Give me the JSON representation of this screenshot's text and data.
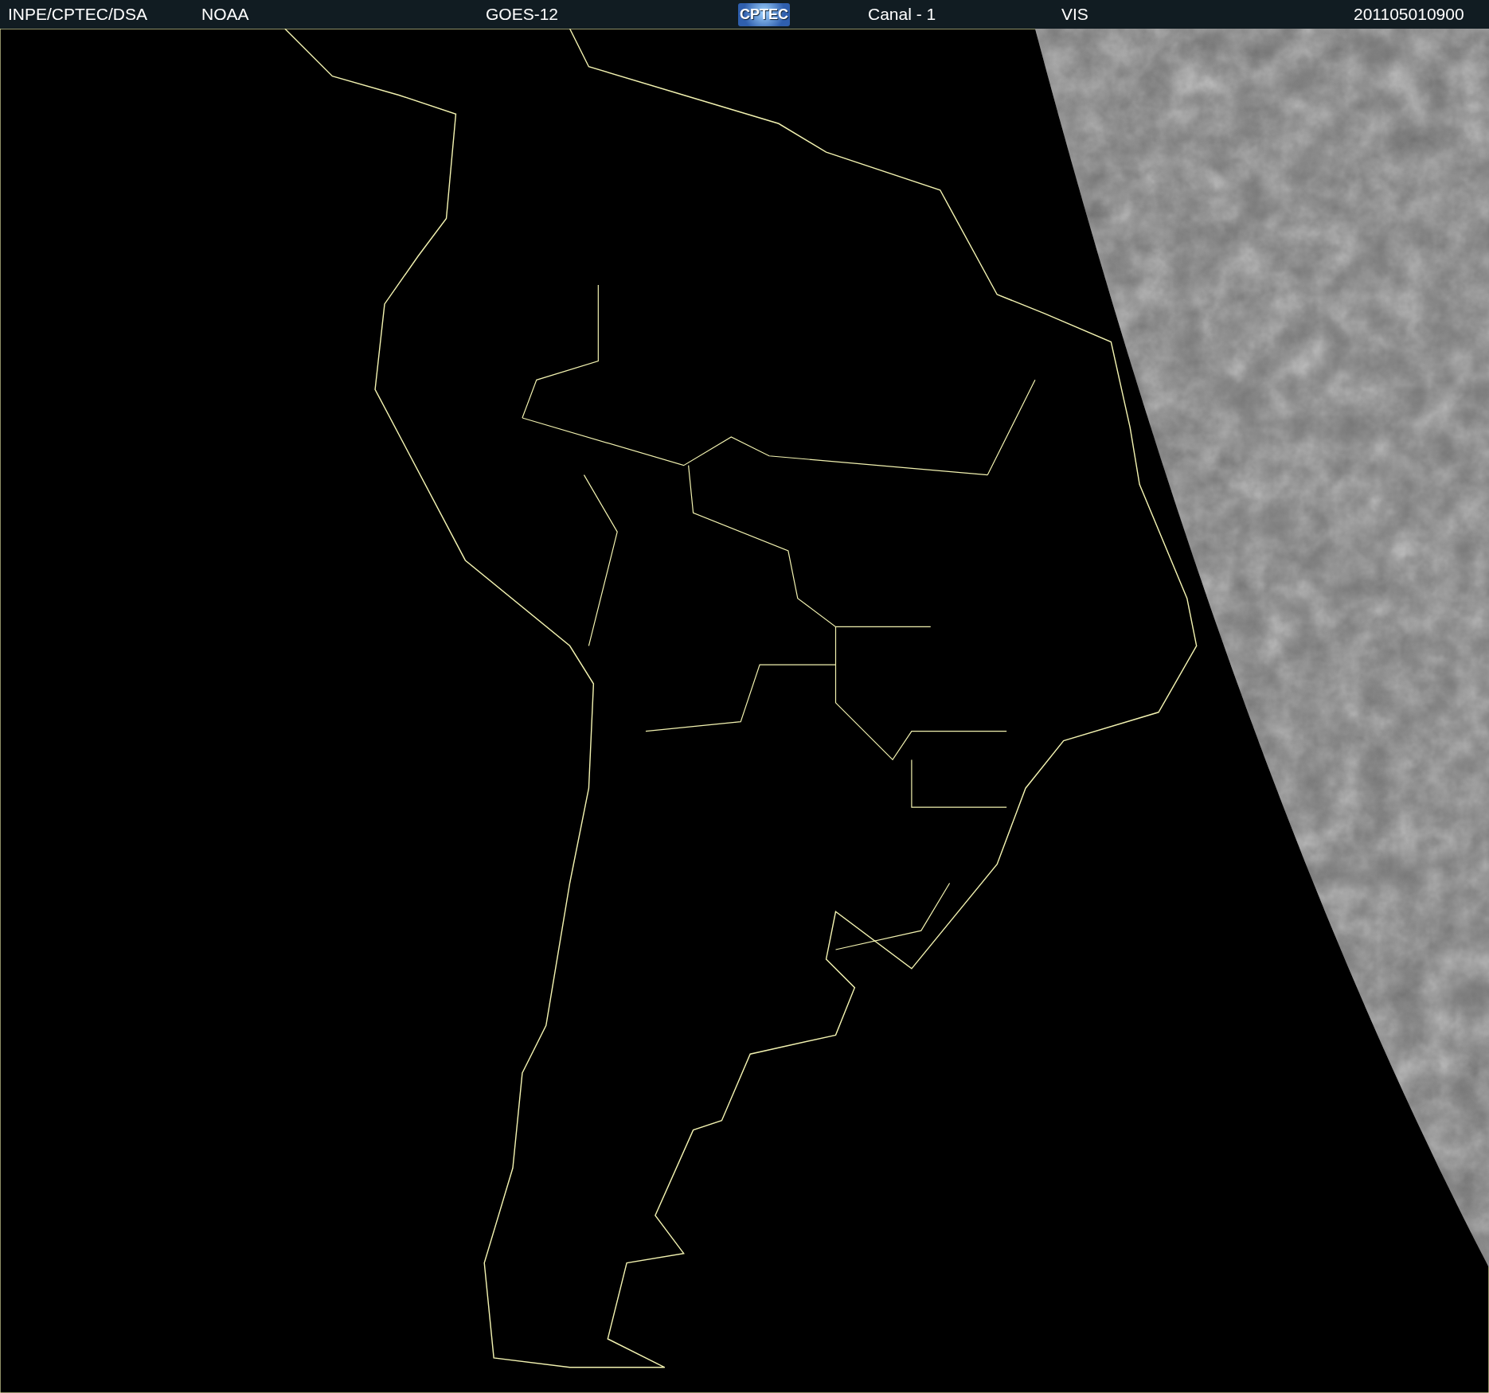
{
  "header": {
    "items": [
      {
        "kind": "text",
        "text": "INPE/CPTEC/DSA"
      },
      {
        "kind": "text",
        "text": "NOAA"
      },
      {
        "kind": "text",
        "text": "GOES-12"
      },
      {
        "kind": "logo",
        "text": "CPTEC"
      },
      {
        "kind": "text",
        "text": "Canal - 1"
      },
      {
        "kind": "text",
        "text": "VIS"
      },
      {
        "kind": "text",
        "text": "201105010900"
      }
    ]
  }
}
